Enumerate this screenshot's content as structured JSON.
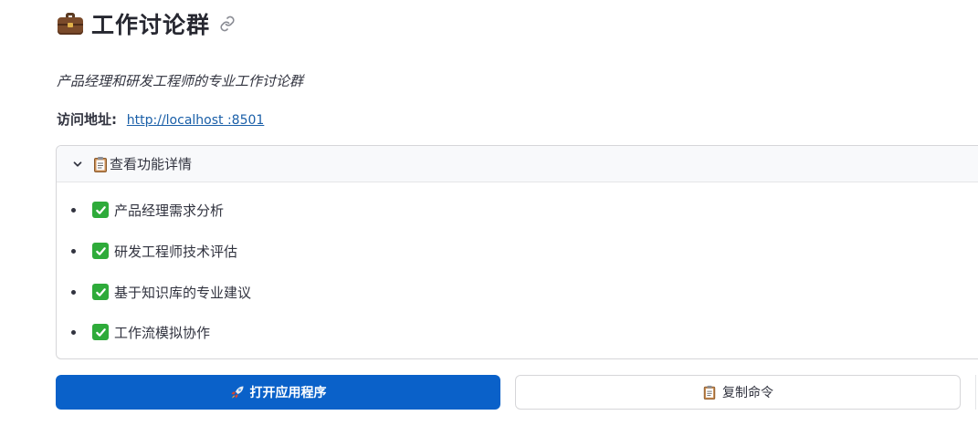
{
  "header": {
    "icon": "briefcase-icon",
    "title": "工作讨论群",
    "anchor_icon": "link-icon"
  },
  "subtitle": "产品经理和研发工程师的专业工作讨论群",
  "access": {
    "label": "访问地址:",
    "url": "http://localhost :8501"
  },
  "expander": {
    "expanded": true,
    "icon": "clipboard-icon",
    "title": "查看功能详情",
    "items": [
      {
        "check_icon": "check-mark-icon",
        "label": "产品经理需求分析"
      },
      {
        "check_icon": "check-mark-icon",
        "label": "研发工程师技术评估"
      },
      {
        "check_icon": "check-mark-icon",
        "label": "基于知识库的专业建议"
      },
      {
        "check_icon": "check-mark-icon",
        "label": "工作流模拟协作"
      }
    ]
  },
  "actions": {
    "open_app": {
      "icon": "rocket-icon",
      "label": "打开应用程序"
    },
    "copy_command": {
      "icon": "clipboard-icon",
      "label": "复制命令"
    }
  },
  "colors": {
    "primary": "#0a61c9",
    "check": "#2eab3a",
    "link": "#1a5fa8",
    "text": "#31333f"
  }
}
